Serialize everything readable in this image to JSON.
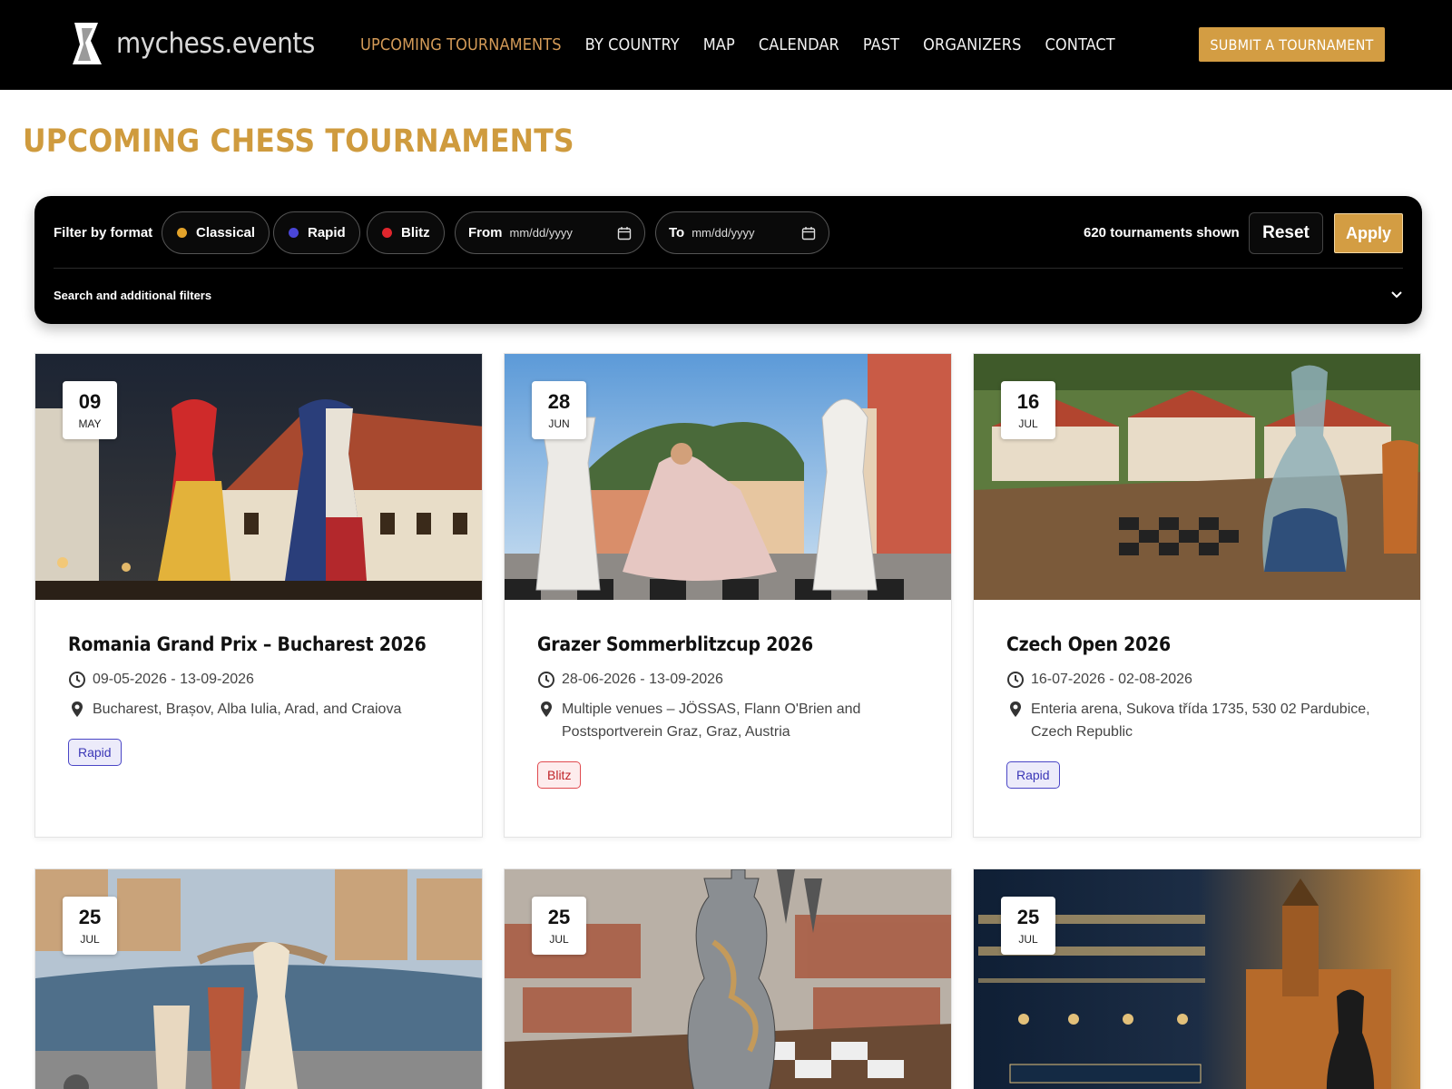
{
  "header": {
    "logo_text": "mychess.events",
    "nav": [
      {
        "label": "UPCOMING TOURNAMENTS"
      },
      {
        "label": "BY COUNTRY"
      },
      {
        "label": "MAP"
      },
      {
        "label": "CALENDAR"
      },
      {
        "label": "PAST"
      },
      {
        "label": "ORGANIZERS"
      },
      {
        "label": "CONTACT"
      }
    ],
    "submit_label": "SUBMIT A TOURNAMENT"
  },
  "page_title": "UPCOMING CHESS TOURNAMENTS",
  "filter": {
    "label": "Filter by format",
    "formats": [
      {
        "label": "Classical",
        "color": "#e3a32a"
      },
      {
        "label": "Rapid",
        "color": "#4a46d8"
      },
      {
        "label": "Blitz",
        "color": "#e0262d"
      }
    ],
    "from_label": "From",
    "to_label": "To",
    "date_placeholder": "mm/dd/yyyy",
    "count_text": "620 tournaments shown",
    "reset_label": "Reset",
    "apply_label": "Apply",
    "search_label": "Search and additional filters"
  },
  "cards": [
    {
      "day": "09",
      "month": "MAY",
      "title": "Romania Grand Prix – Bucharest 2026",
      "dates": "09-05-2026 - 13-09-2026",
      "location": "Bucharest, Brașov, Alba Iulia, Arad, and Craiova",
      "tag": "Rapid"
    },
    {
      "day": "28",
      "month": "JUN",
      "title": "Grazer Sommerblitzcup 2026",
      "dates": "28-06-2026 - 13-09-2026",
      "location": "Multiple venues – JÖSSAS, Flann O'Brien and Postsportverein Graz, Graz, Austria",
      "tag": "Blitz"
    },
    {
      "day": "16",
      "month": "JUL",
      "title": "Czech Open 2026",
      "dates": "16-07-2026 - 02-08-2026",
      "location": "Enteria arena, Sukova třída 1735, 530 02 Pardubice, Czech Republic",
      "tag": "Rapid"
    },
    {
      "day": "25",
      "month": "JUL"
    },
    {
      "day": "25",
      "month": "JUL"
    },
    {
      "day": "25",
      "month": "JUL"
    }
  ],
  "colors": {
    "accent": "#d39d43",
    "nav_active": "#d39a57",
    "title": "#cf9b3e"
  }
}
